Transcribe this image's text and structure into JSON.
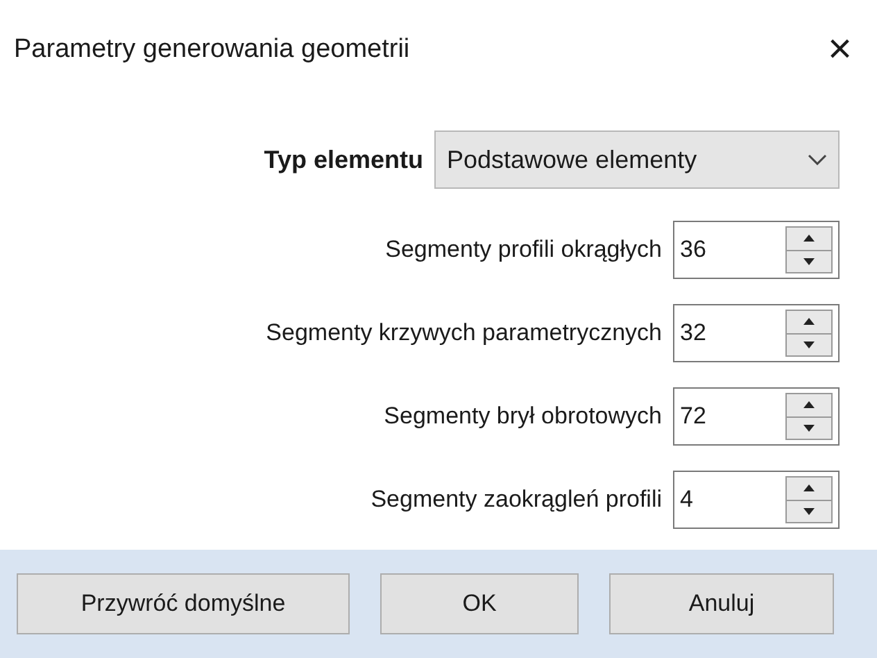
{
  "window": {
    "title": "Parametry generowania geometrii",
    "close": "×"
  },
  "element_type": {
    "label": "Typ elementu",
    "value": "Podstawowe elementy"
  },
  "fields": [
    {
      "label": "Segmenty profili okrągłych",
      "value": "36"
    },
    {
      "label": "Segmenty krzywych parametrycznych",
      "value": "32"
    },
    {
      "label": "Segmenty brył obrotowych",
      "value": "72"
    },
    {
      "label": "Segmenty zaokrągleń profili",
      "value": "4"
    }
  ],
  "buttons": [
    "Przywróć domyślne",
    "OK",
    "Anuluj"
  ]
}
